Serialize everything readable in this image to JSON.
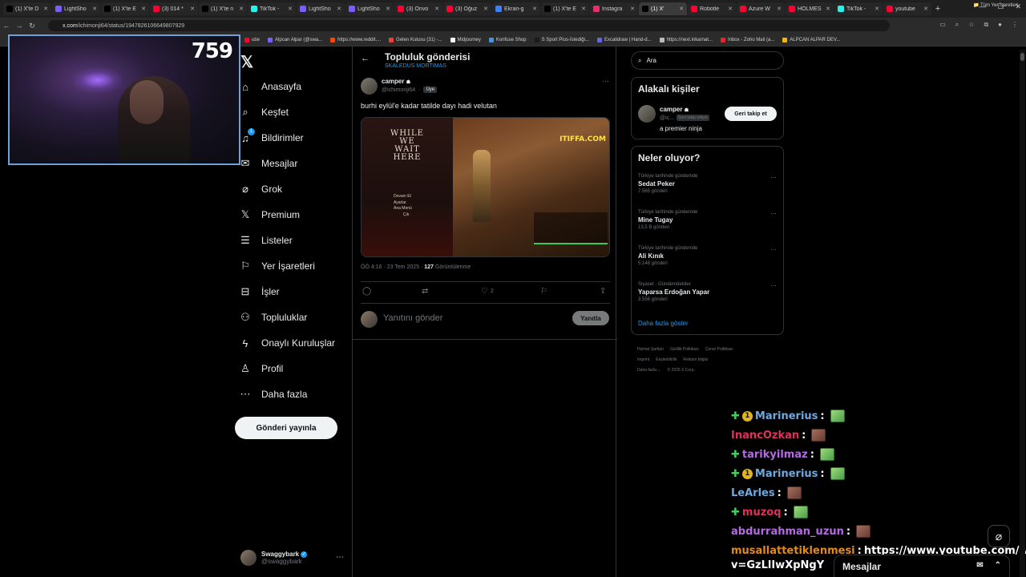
{
  "browser": {
    "tabs": [
      {
        "label": "(1) X'te D",
        "color": "#000000"
      },
      {
        "label": "LightSho",
        "color": "#7c5cff"
      },
      {
        "label": "(1) X'te E",
        "color": "#000000"
      },
      {
        "label": "(3) 014 *",
        "color": "#ff0033"
      },
      {
        "label": "(1) X'te n",
        "color": "#000000"
      },
      {
        "label": "TikTok -",
        "color": "#25f4ee"
      },
      {
        "label": "LightSho",
        "color": "#7c5cff"
      },
      {
        "label": "LightSho",
        "color": "#7c5cff"
      },
      {
        "label": "(3) Onvo",
        "color": "#ff0033"
      },
      {
        "label": "(3) Oğuz",
        "color": "#ff0033"
      },
      {
        "label": "Ekran-g",
        "color": "#3b82f6"
      },
      {
        "label": "(1) X'te E",
        "color": "#000000"
      },
      {
        "label": "Instagra",
        "color": "#e1306c"
      },
      {
        "label": "(1) X'",
        "color": "#000000"
      },
      {
        "label": "Robotle",
        "color": "#ff0033"
      },
      {
        "label": "Azure W",
        "color": "#ff0033"
      },
      {
        "label": "HOLMES",
        "color": "#ff0033"
      },
      {
        "label": "TikTok -",
        "color": "#25f4ee"
      },
      {
        "label": "youtube",
        "color": "#ff0033"
      }
    ],
    "url_host": "x.com",
    "url_path": "/ichimonji64/status/1947826106649807929",
    "bookmarks": [
      {
        "label": "ube",
        "color": "#ff0033"
      },
      {
        "label": "Alpcan Alpar (@swa...",
        "color": "#7c5cff"
      },
      {
        "label": "https://www.reddit....",
        "color": "#ff4500"
      },
      {
        "label": "Gelen Kutusu (31) -...",
        "color": "#ea4335"
      },
      {
        "label": "Midjourney",
        "color": "#ffffff"
      },
      {
        "label": "Konfuse Shop",
        "color": "#4a90e2"
      },
      {
        "label": "S Sport Plus-İstediği...",
        "color": "#1a1a1a"
      },
      {
        "label": "Excalidraw | Hand-d...",
        "color": "#6965db"
      },
      {
        "label": "https://next.inkarnat...",
        "color": "#bbbbbb"
      },
      {
        "label": "Inbox - Zoho Mail (a...",
        "color": "#e42527"
      },
      {
        "label": "ALPCAN ALPAR DEV...",
        "color": "#f2b705"
      }
    ],
    "all_bookmarks": "Tüm Yer İşaretleri"
  },
  "webcam": {
    "counter": "759"
  },
  "nav": {
    "items": [
      {
        "label": "Anasayfa",
        "icon": "home-icon",
        "glyph": "⌂"
      },
      {
        "label": "Keşfet",
        "icon": "search-icon",
        "glyph": "⌕"
      },
      {
        "label": "Bildirimler",
        "icon": "bell-icon",
        "glyph": "♫",
        "badge": "1"
      },
      {
        "label": "Mesajlar",
        "icon": "mail-icon",
        "glyph": "✉"
      },
      {
        "label": "Grok",
        "icon": "grok-icon",
        "glyph": "⌀"
      },
      {
        "label": "Premium",
        "icon": "x-premium-icon",
        "glyph": "𝕏"
      },
      {
        "label": "Listeler",
        "icon": "list-icon",
        "glyph": "☰"
      },
      {
        "label": "Yer İşaretleri",
        "icon": "bookmark-icon",
        "glyph": "⚐"
      },
      {
        "label": "İşler",
        "icon": "briefcase-icon",
        "glyph": "⊟"
      },
      {
        "label": "Topluluklar",
        "icon": "communities-icon",
        "glyph": "⚇"
      },
      {
        "label": "Onaylı Kuruluşlar",
        "icon": "lightning-icon",
        "glyph": "ϟ"
      },
      {
        "label": "Profil",
        "icon": "profile-icon",
        "glyph": "♙"
      },
      {
        "label": "Daha fazla",
        "icon": "more-circle-icon",
        "glyph": "⋯"
      }
    ],
    "post_button": "Gönderi yayınla",
    "account": {
      "name": "Swaggybark",
      "handle": "@swaggybark"
    }
  },
  "main": {
    "title": "Topluluk gönderisi",
    "subtitle": "SKALEDUS MORTIMAS",
    "post": {
      "author_name": "camper",
      "author_handle": "@ichimonji64",
      "member_badge": "Üye",
      "text": "burhi eylül'e kadar tatilde dayı hadi velutan",
      "media": {
        "game_title": "WHILE WE WAIT HERE",
        "menu": [
          "Devam Et",
          "Ayarlar",
          "Ana Menü",
          "Çık"
        ],
        "logo": "ITIFFA.COM"
      },
      "time": "ÖÖ 4:16 · 23 Tem 2025 ·",
      "views_count": "127",
      "views_label": "Görüntülenme",
      "likes": "2"
    },
    "reply_placeholder": "Yanıtını gönder",
    "reply_button": "Yanıtla"
  },
  "right": {
    "search_placeholder": "Ara",
    "related_title": "Alakalı kişiler",
    "related": {
      "name": "camper",
      "handle": "@ic...",
      "follows_you": "Seni takip ediyor",
      "bio": "a premier ninja",
      "button": "Geri takip et"
    },
    "trends_title": "Neler oluyor?",
    "trends": [
      {
        "context": "Türkiye tarihinde gündemde",
        "title": "Sedat Peker",
        "count": "7.565 gönderi"
      },
      {
        "context": "Türkiye tarihinde gündemde",
        "title": "Mine Tugay",
        "count": "13,5 B gönderi"
      },
      {
        "context": "Türkiye tarihinde gündemde",
        "title": "Ali Kınık",
        "count": "5.148 gönderi"
      },
      {
        "context": "Siyaset · Gündemdekiler",
        "title": "Yaparsa Erdoğan Yapar",
        "count": "3.556 gönderi"
      }
    ],
    "show_more": "Daha fazla göster",
    "footer": [
      "Hizmet Şartları",
      "Gizlilik Politikası",
      "Çerez Politikası",
      "Imprint",
      "Erişilebilirlik",
      "Reklam bilgisi",
      "Daha fazla ...",
      "© 2025 X Corp."
    ]
  },
  "chat": {
    "messages": [
      {
        "user": "Marinerius",
        "color": "#6fa8dc",
        "badges": true,
        "emote": "green"
      },
      {
        "user": "InancOzkan",
        "color": "#e0315a",
        "badges": false,
        "emote": "brown"
      },
      {
        "user": "tarikyilmaz",
        "color": "#b36be0",
        "badges": "plus",
        "emote": "green"
      },
      {
        "user": "Marinerius",
        "color": "#6fa8dc",
        "badges": true,
        "emote": "green"
      },
      {
        "user": "LeArles",
        "color": "#6fa8dc",
        "badges": false,
        "emote": "brown"
      },
      {
        "user": "muzoq",
        "color": "#e0315a",
        "badges": "plus",
        "emote": "green"
      },
      {
        "user": "abdurrahman_uzun",
        "color": "#b36be0",
        "badges": false,
        "emote": "brown"
      },
      {
        "user": "musallattetiklenmesi",
        "color": "#e08b1a",
        "badges": false,
        "text": "https://www.youtube.com/watch?"
      }
    ],
    "continuation": "v=GzLlIwXpNgY"
  },
  "drawer": {
    "label": "Mesajlar"
  }
}
